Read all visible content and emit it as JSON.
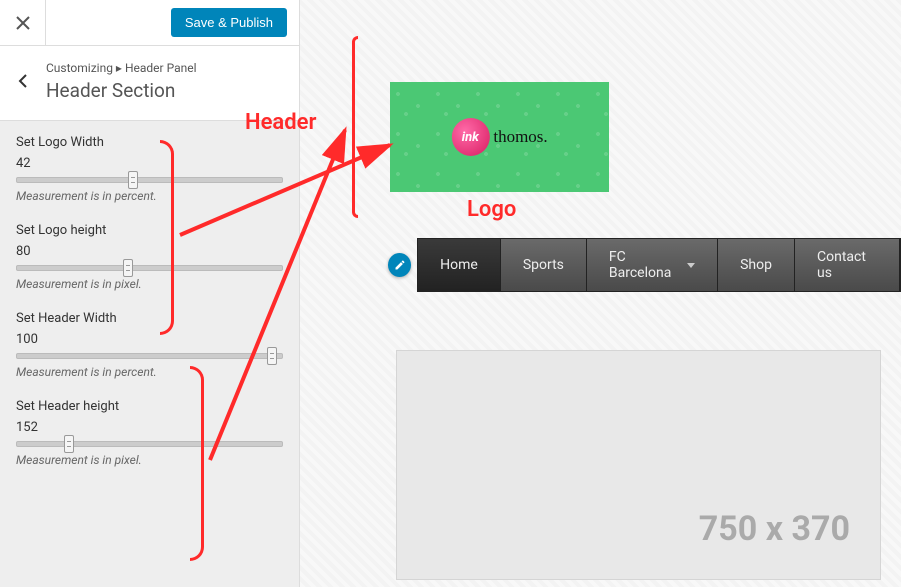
{
  "panel": {
    "save_label": "Save & Publish",
    "breadcrumb_prefix": "Customizing",
    "breadcrumb_panel": "Header Panel",
    "section_title": "Header Section",
    "controls": [
      {
        "label": "Set Logo Width",
        "value": "42",
        "hint": "Measurement is in percent.",
        "pos": 42
      },
      {
        "label": "Set Logo height",
        "value": "80",
        "hint": "Measurement is in pixel.",
        "pos": 40
      },
      {
        "label": "Set Header Width",
        "value": "100",
        "hint": "Measurement is in percent.",
        "pos": 94
      },
      {
        "label": "Set Header height",
        "value": "152",
        "hint": "Measurement is in pixel.",
        "pos": 18
      }
    ]
  },
  "annotations": {
    "header_label": "Header",
    "logo_label": "Logo"
  },
  "preview": {
    "logo": {
      "ink": "ink",
      "themes": "thomos."
    },
    "nav": [
      {
        "label": "Home",
        "active": true,
        "dropdown": false
      },
      {
        "label": "Sports",
        "active": false,
        "dropdown": false
      },
      {
        "label": "FC Barcelona",
        "active": false,
        "dropdown": true
      },
      {
        "label": "Shop",
        "active": false,
        "dropdown": false
      },
      {
        "label": "Contact us",
        "active": false,
        "dropdown": false
      }
    ],
    "placeholder_text": "750 x 370"
  }
}
